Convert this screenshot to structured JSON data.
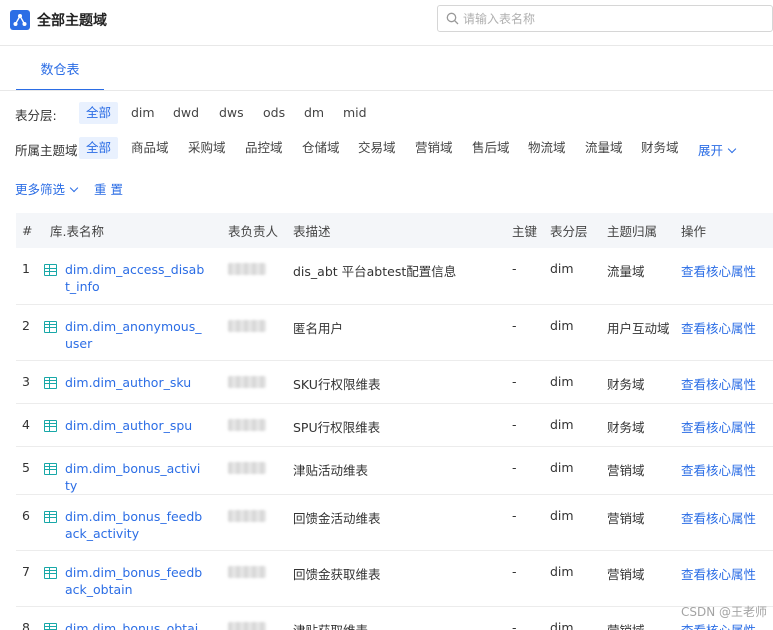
{
  "header": {
    "title": "全部主题域",
    "search_placeholder": "请输入表名称"
  },
  "tabs": [
    {
      "label": "数仓表",
      "active": true
    }
  ],
  "filters": {
    "layer_label": "表分层:",
    "layers": [
      "全部",
      "dim",
      "dwd",
      "dws",
      "ods",
      "dm",
      "mid"
    ],
    "domain_label": "所属主题域:",
    "domains": [
      "全部",
      "商品域",
      "采购域",
      "品控域",
      "仓储域",
      "交易域",
      "营销域",
      "售后域",
      "物流域",
      "流量域",
      "财务域"
    ],
    "expand_label": "展开",
    "more_filter_label": "更多筛选",
    "reset_label": "重 置"
  },
  "table": {
    "columns": [
      "#",
      "库.表名称",
      "表负责人",
      "表描述",
      "主键",
      "表分层",
      "主题归属",
      "操作"
    ],
    "rows": [
      {
        "index": "1",
        "name": "dim.dim_access_disabt_info",
        "desc": "dis_abt 平台abtest配置信息",
        "pk": "-",
        "layer": "dim",
        "domain": "流量域",
        "action": "查看核心属性"
      },
      {
        "index": "2",
        "name": "dim.dim_anonymous_user",
        "desc": "匿名用户",
        "pk": "-",
        "layer": "dim",
        "domain": "用户互动域",
        "action": "查看核心属性"
      },
      {
        "index": "3",
        "name": "dim.dim_author_sku",
        "desc": "SKU行权限维表",
        "pk": "-",
        "layer": "dim",
        "domain": "财务域",
        "action": "查看核心属性"
      },
      {
        "index": "4",
        "name": "dim.dim_author_spu",
        "desc": "SPU行权限维表",
        "pk": "-",
        "layer": "dim",
        "domain": "财务域",
        "action": "查看核心属性"
      },
      {
        "index": "5",
        "name": "dim.dim_bonus_activity",
        "desc": "津贴活动维表",
        "pk": "-",
        "layer": "dim",
        "domain": "营销域",
        "action": "查看核心属性"
      },
      {
        "index": "6",
        "name": "dim.dim_bonus_feedback_activity",
        "desc": "回馈金活动维表",
        "pk": "-",
        "layer": "dim",
        "domain": "营销域",
        "action": "查看核心属性"
      },
      {
        "index": "7",
        "name": "dim.dim_bonus_feedback_obtain",
        "desc": "回馈金获取维表",
        "pk": "-",
        "layer": "dim",
        "domain": "营销域",
        "action": "查看核心属性"
      },
      {
        "index": "8",
        "name": "dim.dim_bonus_obtain",
        "desc": "津贴获取维表",
        "pk": "-",
        "layer": "dim",
        "domain": "营销域",
        "action": "查看核心属性"
      }
    ]
  },
  "watermark": "CSDN @王老师",
  "colors": {
    "accent": "#2b6de5",
    "table_icon": "#18a8a8",
    "active_chip_bg": "#e9f1fe"
  }
}
